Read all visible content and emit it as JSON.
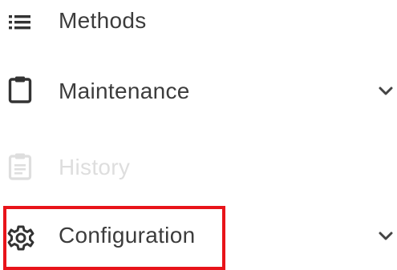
{
  "nav": {
    "items": [
      {
        "label": "Methods",
        "icon": "list-icon",
        "state": "enabled"
      },
      {
        "label": "Maintenance",
        "icon": "clipboard-icon",
        "state": "enabled",
        "expandable": true
      },
      {
        "label": "History",
        "icon": "clipboard-list-icon",
        "state": "disabled"
      },
      {
        "label": "Configuration",
        "icon": "gear-icon",
        "state": "enabled",
        "expandable": true,
        "highlighted": true
      }
    ]
  },
  "colors": {
    "text": "#3c3c3c",
    "icon": "#333333",
    "disabled": "#dedede",
    "highlight": "#e8141a"
  }
}
